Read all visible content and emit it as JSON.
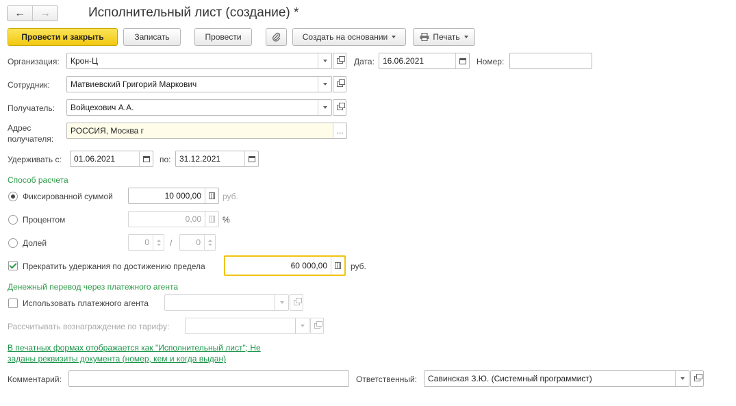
{
  "header": {
    "title": "Исполнительный лист (создание) *",
    "back_icon": "←",
    "forward_icon": "→"
  },
  "toolbar": {
    "post_close": "Провести и закрыть",
    "save": "Записать",
    "post": "Провести",
    "create_based": "Создать на основании",
    "print": "Печать"
  },
  "form": {
    "organization_label": "Организация:",
    "organization_value": "Крон-Ц",
    "date_label": "Дата:",
    "date_value": "16.06.2021",
    "number_label": "Номер:",
    "number_value": "",
    "employee_label": "Сотрудник:",
    "employee_value": "Матвиевский Григорий Маркович",
    "recipient_label": "Получатель:",
    "recipient_value": "Войцехович А.А.",
    "address_label_1": "Адрес",
    "address_label_2": "получателя:",
    "address_value": "РОССИЯ, Москва г",
    "withhold_from_label": "Удерживать с:",
    "withhold_from_value": "01.06.2021",
    "withhold_to_label": "по:",
    "withhold_to_value": "31.12.2021"
  },
  "calc": {
    "section_title": "Способ расчета",
    "fixed_label": "Фиксированной суммой",
    "fixed_value": "10 000,00",
    "fixed_unit": "руб.",
    "percent_label": "Процентом",
    "percent_value": "0,00",
    "percent_unit": "%",
    "share_label": "Долей",
    "share_num": "0",
    "share_sep": "/",
    "share_den": "0",
    "selected": "fixed",
    "limit_label": "Прекратить удержания по достижению предела",
    "limit_checked": true,
    "limit_value": "60 000,00",
    "limit_unit": "руб."
  },
  "agent": {
    "section_title": "Денежный перевод через платежного агента",
    "use_agent_label": "Использовать платежного агента",
    "use_agent_checked": false,
    "use_agent_value": "",
    "tariff_label": "Рассчитывать вознаграждение по тарифу:",
    "tariff_value": ""
  },
  "print_link": {
    "line1": "В печатных формах отображается как \"Исполнительный лист\"; Не",
    "line2": "заданы реквизиты документа (номер, кем и когда выдан)"
  },
  "footer": {
    "comment_label": "Комментарий:",
    "comment_value": "",
    "responsible_label": "Ответственный:",
    "responsible_value": "Савинская З.Ю. (Системный программист)"
  },
  "colors": {
    "primary_button": "#f2c810",
    "section_green": "#2e9b48",
    "focus_border": "#f1c40f"
  }
}
